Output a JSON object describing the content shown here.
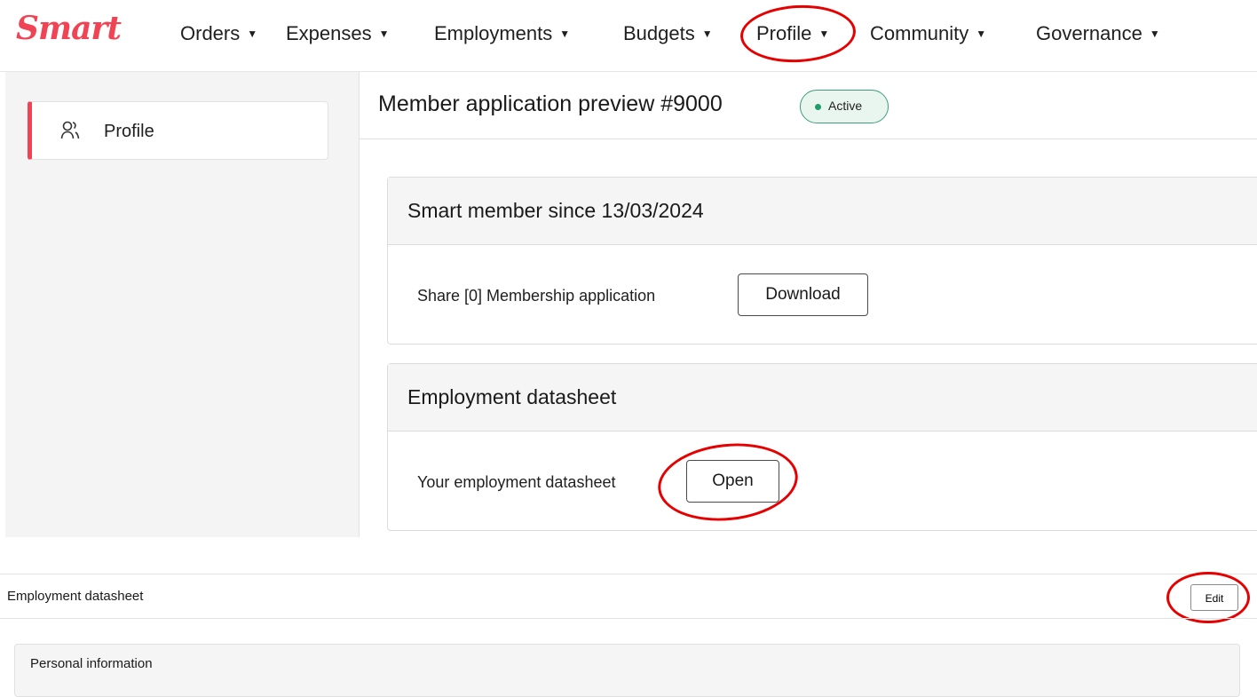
{
  "brand": {
    "logo_text": "Smart",
    "accent_color": "#f04455"
  },
  "nav": {
    "items": [
      {
        "label": "Orders"
      },
      {
        "label": "Expenses"
      },
      {
        "label": "Employments"
      },
      {
        "label": "Budgets"
      },
      {
        "label": "Profile"
      },
      {
        "label": "Community"
      },
      {
        "label": "Governance"
      }
    ],
    "caret_icon": "caret-down-icon"
  },
  "sidebar": {
    "items": [
      {
        "label": "Profile",
        "icon": "users-icon",
        "active": true
      }
    ]
  },
  "header": {
    "title": "Member application preview #9000",
    "status": {
      "label": "Active",
      "color": "#1f9d6a"
    }
  },
  "cards": {
    "membership": {
      "title": "Smart member since 13/03/2024",
      "text": "Share [0] Membership application",
      "button": "Download"
    },
    "employment": {
      "title": "Employment datasheet",
      "text": "Your employment datasheet",
      "button": "Open"
    }
  },
  "bottom": {
    "title": "Employment datasheet",
    "edit_button": "Edit",
    "section_title": "Personal information"
  },
  "annotations": {
    "color": "#e60000"
  }
}
